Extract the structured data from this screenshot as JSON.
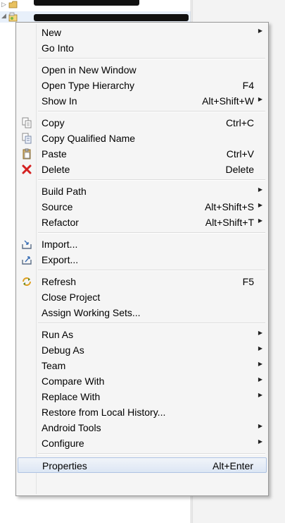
{
  "menu": {
    "sections": [
      [
        {
          "label": "New",
          "accel": "",
          "submenu": true,
          "icon": ""
        },
        {
          "label": "Go Into",
          "accel": "",
          "submenu": false,
          "icon": ""
        }
      ],
      [
        {
          "label": "Open in New Window",
          "accel": "",
          "submenu": false,
          "icon": ""
        },
        {
          "label": "Open Type Hierarchy",
          "accel": "F4",
          "submenu": false,
          "icon": ""
        },
        {
          "label": "Show In",
          "accel": "Alt+Shift+W",
          "submenu": true,
          "icon": ""
        }
      ],
      [
        {
          "label": "Copy",
          "accel": "Ctrl+C",
          "submenu": false,
          "icon": "copy-icon"
        },
        {
          "label": "Copy Qualified Name",
          "accel": "",
          "submenu": false,
          "icon": "copy-qualified-name-icon"
        },
        {
          "label": "Paste",
          "accel": "Ctrl+V",
          "submenu": false,
          "icon": "paste-icon"
        },
        {
          "label": "Delete",
          "accel": "Delete",
          "submenu": false,
          "icon": "delete-icon"
        }
      ],
      [
        {
          "label": "Build Path",
          "accel": "",
          "submenu": true,
          "icon": ""
        },
        {
          "label": "Source",
          "accel": "Alt+Shift+S",
          "submenu": true,
          "icon": ""
        },
        {
          "label": "Refactor",
          "accel": "Alt+Shift+T",
          "submenu": true,
          "icon": ""
        }
      ],
      [
        {
          "label": "Import...",
          "accel": "",
          "submenu": false,
          "icon": "import-icon"
        },
        {
          "label": "Export...",
          "accel": "",
          "submenu": false,
          "icon": "export-icon"
        }
      ],
      [
        {
          "label": "Refresh",
          "accel": "F5",
          "submenu": false,
          "icon": "refresh-icon"
        },
        {
          "label": "Close Project",
          "accel": "",
          "submenu": false,
          "icon": ""
        },
        {
          "label": "Assign Working Sets...",
          "accel": "",
          "submenu": false,
          "icon": ""
        }
      ],
      [
        {
          "label": "Run As",
          "accel": "",
          "submenu": true,
          "icon": ""
        },
        {
          "label": "Debug As",
          "accel": "",
          "submenu": true,
          "icon": ""
        },
        {
          "label": "Team",
          "accel": "",
          "submenu": true,
          "icon": ""
        },
        {
          "label": "Compare With",
          "accel": "",
          "submenu": true,
          "icon": ""
        },
        {
          "label": "Replace With",
          "accel": "",
          "submenu": true,
          "icon": ""
        },
        {
          "label": "Restore from Local History...",
          "accel": "",
          "submenu": false,
          "icon": ""
        },
        {
          "label": "Android Tools",
          "accel": "",
          "submenu": true,
          "icon": ""
        },
        {
          "label": "Configure",
          "accel": "",
          "submenu": true,
          "icon": ""
        }
      ],
      [
        {
          "label": "Properties",
          "accel": "Alt+Enter",
          "submenu": false,
          "icon": "",
          "hover": true
        }
      ]
    ]
  },
  "colors": {
    "menu_bg": "#f5f5f5",
    "hover_border": "#aec3e3",
    "delete_red": "#d42020"
  }
}
